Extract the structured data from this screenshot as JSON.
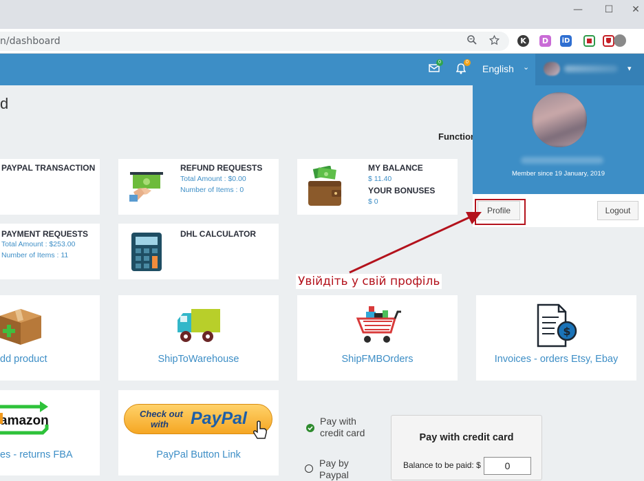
{
  "browser": {
    "url": "n/dashboard",
    "window_controls": {
      "minimize": "—",
      "maximize": "☐",
      "close": "✕"
    },
    "toolbar_icons": [
      "zoom-icon",
      "bookmark-star-icon"
    ],
    "extensions": [
      {
        "letter": "K",
        "color": "#3a3a3a"
      },
      {
        "letter": "D",
        "color": "#c96bd6"
      },
      {
        "letter": "iD",
        "color": "#2f6fd1"
      },
      {
        "letter": "",
        "color": "#2e9a4a"
      },
      {
        "letter": "",
        "color": "#c41e25"
      }
    ]
  },
  "navbar": {
    "mail_badge": "0",
    "bell_badge": "0",
    "language": "English",
    "user_name_blurred": ""
  },
  "page": {
    "title_fragment": "d",
    "functions_label": "Function"
  },
  "cards": {
    "paypal_transaction": {
      "title": "PAYPAL TRANSACTION"
    },
    "refund_requests": {
      "title": "REFUND REQUESTS",
      "total": "Total Amount : $0.00",
      "items": "Number of Items : 0"
    },
    "my_balance": {
      "title": "MY BALANCE",
      "balance": "$ 11.40",
      "bonus_title": "YOUR BONUSES",
      "bonus": "$ 0"
    },
    "payment_requests": {
      "title": "PAYMENT REQUESTS",
      "total": "Total Amount : $253.00",
      "items": "Number of Items : 11"
    },
    "dhl_calculator": {
      "title": "DHL CALCULATOR"
    }
  },
  "tiles": {
    "add_product": "dd product",
    "ship_to_warehouse": "ShipToWarehouse",
    "ship_fmb_orders": "ShipFMBOrders",
    "invoices": "Invoices - orders Etsy, Ebay",
    "amazon_returns": "es - returns FBA",
    "amazon_logo_text": "amazon",
    "paypal_button": "PayPal Button Link",
    "paypal_checkout_top": "Check out",
    "paypal_checkout_with": "with",
    "paypal_brand": "PayPal"
  },
  "dropdown": {
    "member_since": "Member since 19 January, 2019",
    "profile_button": "Profile",
    "logout_button": "Logout"
  },
  "annotation": {
    "text": "Увійдіть у свій профіль",
    "color": "#b3121c"
  },
  "payment": {
    "option_card": "Pay with\ncredit card",
    "option_card_line1": "Pay with",
    "option_card_line2": "credit card",
    "option_paypal_line1": "Pay by",
    "option_paypal_line2": "Paypal",
    "panel_title": "Pay with credit card",
    "balance_label": "Balance to be paid: $",
    "balance_value": "0"
  },
  "colors": {
    "navbar": "#3d8ec6",
    "link": "#3d8ec6",
    "background": "#eceff1"
  }
}
